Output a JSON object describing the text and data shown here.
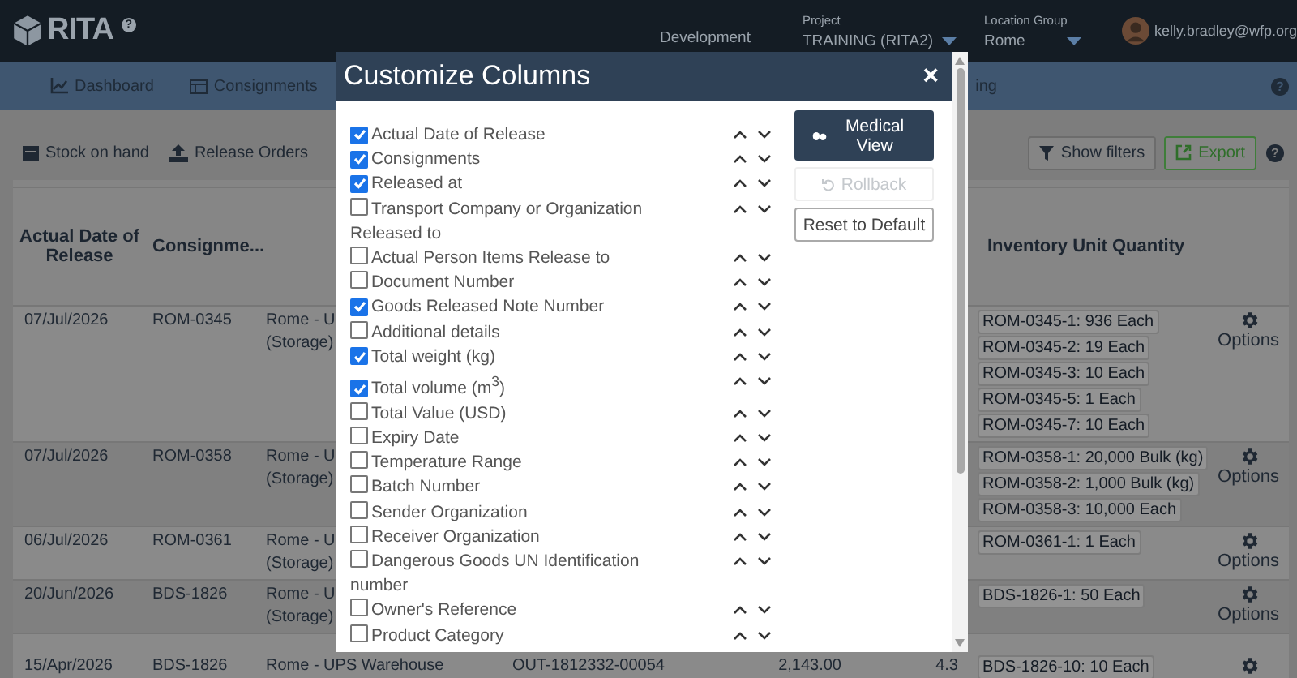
{
  "header": {
    "logo": "RITA",
    "help": "?",
    "environment": "Development",
    "project": {
      "label": "Project",
      "value": "TRAINING (RITA2)"
    },
    "location_group": {
      "label": "Location Group",
      "value": "Rome"
    },
    "user": "kelly.bradley@wfp.org"
  },
  "nav": {
    "items": [
      {
        "label": "Dashboard"
      },
      {
        "label": "Consignments"
      },
      {
        "label": "ing"
      }
    ],
    "help": "?"
  },
  "toolbar": {
    "left": [
      {
        "label": "Stock on hand"
      },
      {
        "label": "Release Orders"
      }
    ],
    "right": [
      {
        "label": "Show filters",
        "kind": "filter"
      },
      {
        "label": "Export",
        "kind": "export"
      }
    ],
    "help": "?"
  },
  "table": {
    "columns": {
      "column_1": "Actual Date of Release",
      "column_2": "Consignme...",
      "column_7": "Inventory Unit Quantity"
    },
    "rows": [
      {
        "column_1": "07/Jul/2026",
        "column_2": "ROM-0345",
        "column_3": [
          "Rome - U",
          "(Storage)"
        ],
        "column_7": [
          "ROM-0345-1: 936 Each",
          "ROM-0345-2: 19 Each",
          "ROM-0345-3: 10 Each",
          "ROM-0345-5: 1 Each",
          "ROM-0345-7: 10 Each"
        ],
        "options": "Options"
      },
      {
        "column_1": "07/Jul/2026",
        "column_2": "ROM-0358",
        "column_3": [
          "Rome - U",
          "(Storage)"
        ],
        "column_7": [
          "ROM-0358-1: 20,000 Bulk (kg)",
          "ROM-0358-2: 1,000 Bulk (kg)",
          "ROM-0358-3: 10,000 Each"
        ],
        "options": "Options"
      },
      {
        "column_1": "06/Jul/2026",
        "column_2": "ROM-0361",
        "column_3": [
          "Rome - U",
          "(Storage)"
        ],
        "column_7": [
          "ROM-0361-1: 1 Each"
        ],
        "options": "Options"
      },
      {
        "column_1": "20/Jun/2026",
        "column_2": "BDS-1826",
        "column_3": [
          "Rome - U",
          "(Storage)"
        ],
        "column_7": [
          "BDS-1826-1: 50 Each"
        ],
        "options": "Options"
      },
      {
        "column_1": "15/Apr/2026",
        "column_2": "BDS-1826",
        "column_3": [
          "Rome - UPS Warehouse"
        ],
        "column_4": "OUT-1812332-00054",
        "column_5": "2,143.00",
        "column_6": "4.3",
        "column_7": [
          "BDS-1826-10: 10 Each"
        ]
      }
    ]
  },
  "modal": {
    "title": "Customize Columns",
    "close": "×",
    "items": [
      {
        "label": "Actual Date of Release",
        "checked": true
      },
      {
        "label": "Consignments",
        "checked": true
      },
      {
        "label": "Released at",
        "checked": true
      },
      {
        "label": "Transport Company or Organization Released to",
        "checked": false
      },
      {
        "label": "Actual Person Items Release to",
        "checked": false
      },
      {
        "label": "Document Number",
        "checked": false
      },
      {
        "label": "Goods Released Note Number",
        "checked": true
      },
      {
        "label": "Additional details",
        "checked": false
      },
      {
        "label": "Total weight (kg)",
        "checked": true
      },
      {
        "label": "Total volume (m$^{3}$)",
        "checked": true
      },
      {
        "label": "Total Value (USD)",
        "checked": false
      },
      {
        "label": "Expiry Date",
        "checked": false
      },
      {
        "label": "Temperature Range",
        "checked": false
      },
      {
        "label": "Batch Number",
        "checked": false
      },
      {
        "label": "Sender Organization",
        "checked": false
      },
      {
        "label": "Receiver Organization",
        "checked": false
      },
      {
        "label": "Dangerous Goods UN Identification number",
        "checked": false
      },
      {
        "label": "Owner's Reference",
        "checked": false
      },
      {
        "label": "Product Category",
        "checked": false
      }
    ],
    "buttons": [
      {
        "label": "Medical View",
        "kind": "medical",
        "disabled": false
      },
      {
        "label": "Rollback",
        "kind": "rollback",
        "disabled": true
      },
      {
        "label": "Reset to Default",
        "kind": "reset",
        "disabled": false
      }
    ]
  }
}
